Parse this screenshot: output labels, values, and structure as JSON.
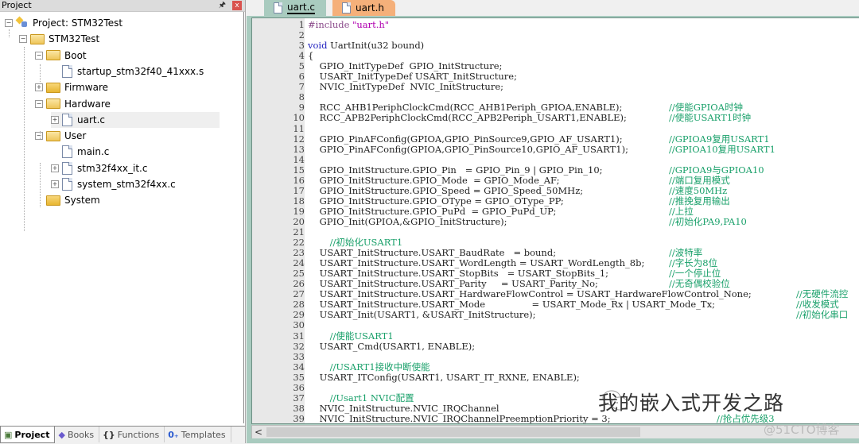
{
  "project_panel": {
    "title": "Project",
    "tree": [
      {
        "label": "Project: STM32Test",
        "type": "project",
        "expander": "minus"
      },
      {
        "label": "STM32Test",
        "type": "target",
        "expander": "minus"
      },
      {
        "label": "Boot",
        "type": "folder-open",
        "expander": "minus"
      },
      {
        "label": "startup_stm32f40_41xxx.s",
        "type": "file",
        "expander": "none"
      },
      {
        "label": "Firmware",
        "type": "folder",
        "expander": "plus"
      },
      {
        "label": "Hardware",
        "type": "folder-open",
        "expander": "minus"
      },
      {
        "label": "uart.c",
        "type": "file",
        "expander": "plus",
        "selected": true
      },
      {
        "label": "User",
        "type": "folder-open",
        "expander": "minus"
      },
      {
        "label": "main.c",
        "type": "file",
        "expander": "none"
      },
      {
        "label": "stm32f4xx_it.c",
        "type": "file",
        "expander": "plus"
      },
      {
        "label": "system_stm32f4xx.c",
        "type": "file",
        "expander": "plus"
      },
      {
        "label": "System",
        "type": "folder",
        "expander": "none"
      }
    ],
    "bottom_tabs": [
      {
        "label": "Project",
        "icon": "project-icon",
        "active": true
      },
      {
        "label": "Books",
        "icon": "books-icon"
      },
      {
        "label": "Functions",
        "icon": "functions-icon"
      },
      {
        "label": "Templates",
        "icon": "templates-icon"
      }
    ]
  },
  "editor": {
    "tabs": [
      {
        "label": "uart.c",
        "active": true,
        "color": "#a9cbbf"
      },
      {
        "label": "uart.h",
        "active": false,
        "color": "#f5b07a"
      }
    ],
    "lines": [
      {
        "n": "1",
        "code": "#include \"uart.h\""
      },
      {
        "n": "2",
        "code": ""
      },
      {
        "n": "3",
        "code": "void UartInit(u32 bound)"
      },
      {
        "n": "4",
        "code": "{"
      },
      {
        "n": "5",
        "code": "    GPIO_InitTypeDef  GPIO_InitStructure;"
      },
      {
        "n": "6",
        "code": "    USART_InitTypeDef USART_InitStructure;"
      },
      {
        "n": "7",
        "code": "    NVIC_InitTypeDef  NVIC_InitStructure;"
      },
      {
        "n": "8",
        "code": ""
      },
      {
        "n": "9",
        "code": "    RCC_AHB1PeriphClockCmd(RCC_AHB1Periph_GPIOA,ENABLE);",
        "comment": "//使能GPIOA时钟"
      },
      {
        "n": "10",
        "code": "    RCC_APB2PeriphClockCmd(RCC_APB2Periph_USART1,ENABLE);",
        "comment": "//使能USART1时钟"
      },
      {
        "n": "11",
        "code": ""
      },
      {
        "n": "12",
        "code": "    GPIO_PinAFConfig(GPIOA,GPIO_PinSource9,GPIO_AF_USART1);",
        "comment": "//GPIOA9复用USART1"
      },
      {
        "n": "13",
        "code": "    GPIO_PinAFConfig(GPIOA,GPIO_PinSource10,GPIO_AF_USART1);",
        "comment": "//GPIOA10复用USART1"
      },
      {
        "n": "14",
        "code": ""
      },
      {
        "n": "15",
        "code": "    GPIO_InitStructure.GPIO_Pin   = GPIO_Pin_9 | GPIO_Pin_10;",
        "comment": "//GPIOA9与GPIOA10"
      },
      {
        "n": "16",
        "code": "    GPIO_InitStructure.GPIO_Mode  = GPIO_Mode_AF;",
        "comment": "//端口复用模式"
      },
      {
        "n": "17",
        "code": "    GPIO_InitStructure.GPIO_Speed = GPIO_Speed_50MHz;",
        "comment": "//速度50MHz"
      },
      {
        "n": "18",
        "code": "    GPIO_InitStructure.GPIO_OType = GPIO_OType_PP;",
        "comment": "//推挽复用输出"
      },
      {
        "n": "19",
        "code": "    GPIO_InitStructure.GPIO_PuPd  = GPIO_PuPd_UP;",
        "comment": "//上拉"
      },
      {
        "n": "20",
        "code": "    GPIO_Init(GPIOA,&GPIO_InitStructure);",
        "comment": "//初始化PA9,PA10"
      },
      {
        "n": "21",
        "code": ""
      },
      {
        "n": "22",
        "code": "    ",
        "comment": "//初始化USART1"
      },
      {
        "n": "23",
        "code": "    USART_InitStructure.USART_BaudRate   = bound;",
        "comment": "//波特率"
      },
      {
        "n": "24",
        "code": "    USART_InitStructure.USART_WordLength = USART_WordLength_8b;",
        "comment": "//字长为8位"
      },
      {
        "n": "25",
        "code": "    USART_InitStructure.USART_StopBits   = USART_StopBits_1;",
        "comment": "//一个停止位"
      },
      {
        "n": "26",
        "code": "    USART_InitStructure.USART_Parity     = USART_Parity_No;",
        "comment": "//无奇偶校验位"
      },
      {
        "n": "27",
        "code": "    USART_InitStructure.USART_HardwareFlowControl = USART_HardwareFlowControl_None;",
        "comment": "//无硬件流控"
      },
      {
        "n": "28",
        "code": "    USART_InitStructure.USART_Mode                = USART_Mode_Rx | USART_Mode_Tx;",
        "comment": "//收发模式"
      },
      {
        "n": "29",
        "code": "    USART_Init(USART1, &USART_InitStructure);",
        "comment": "//初始化串口"
      },
      {
        "n": "30",
        "code": ""
      },
      {
        "n": "31",
        "code": "    ",
        "comment": "//使能USART1"
      },
      {
        "n": "32",
        "code": "    USART_Cmd(USART1, ENABLE);"
      },
      {
        "n": "33",
        "code": ""
      },
      {
        "n": "34",
        "code": "    ",
        "comment": "//USART1接收中断使能"
      },
      {
        "n": "35",
        "code": "    USART_ITConfig(USART1, USART_IT_RXNE, ENABLE);"
      },
      {
        "n": "36",
        "code": ""
      },
      {
        "n": "37",
        "code": "    ",
        "comment": "//Usart1 NVIC配置"
      },
      {
        "n": "38",
        "code": "    NVIC_InitStructure.NVIC_IRQChannel"
      },
      {
        "n": "39",
        "code": "    NVIC_InitStructure.NVIC_IRQChannelPreemptionPriority = 3;",
        "comment": "//抢占优先级3"
      }
    ],
    "scroll_left_label": "<"
  },
  "watermark": {
    "text": "我的嵌入式开发之路",
    "source": "@51CTO博客"
  }
}
